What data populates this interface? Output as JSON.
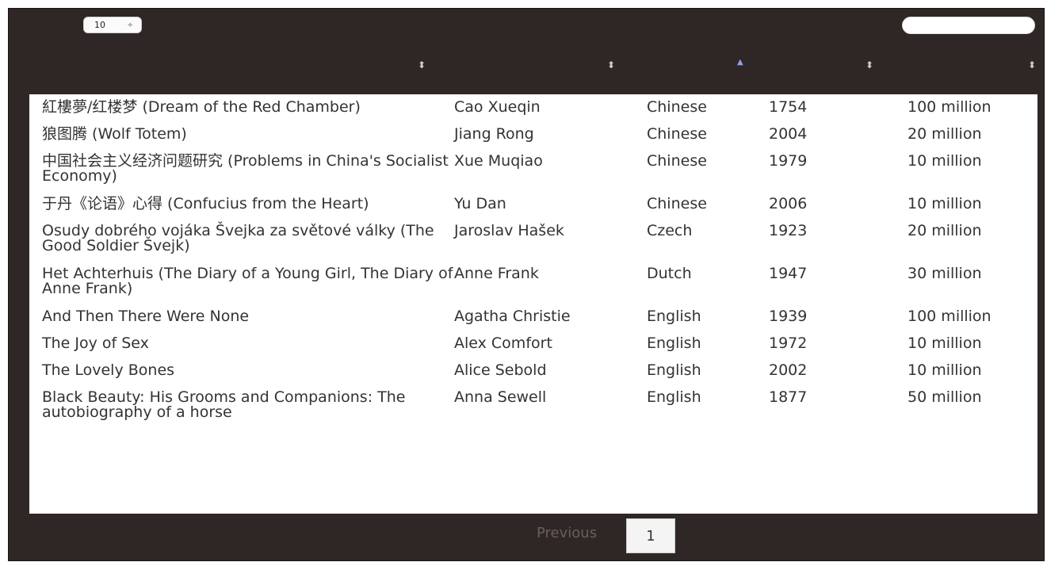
{
  "controls": {
    "page_length": "10",
    "page_length_arrows": "÷",
    "search_value": ""
  },
  "sort_icons": {
    "unsorted": "⬍",
    "ascending": "▲"
  },
  "rows": [
    {
      "title": "紅樓夢/红楼梦 (Dream of the Red Chamber)",
      "author": "Cao Xueqin",
      "language": "Chinese",
      "year": "1754",
      "sales": "100 million"
    },
    {
      "title": "狼图腾 (Wolf Totem)",
      "author": "Jiang Rong",
      "language": "Chinese",
      "year": "2004",
      "sales": "20 million"
    },
    {
      "title": "中国社会主义经济问题研究 (Problems in China's Socialist Economy)",
      "author": "Xue Muqiao",
      "language": "Chinese",
      "year": "1979",
      "sales": "10 million"
    },
    {
      "title": "于丹《论语》心得 (Confucius from the Heart)",
      "author": "Yu Dan",
      "language": "Chinese",
      "year": "2006",
      "sales": "10 million"
    },
    {
      "title": "Osudy dobrého vojáka Švejka za světové války (The Good Soldier Švejk)",
      "author": "Jaroslav Hašek",
      "language": "Czech",
      "year": "1923",
      "sales": "20 million"
    },
    {
      "title": "Het Achterhuis (The Diary of a Young Girl, The Diary of Anne Frank)",
      "author": "Anne Frank",
      "language": "Dutch",
      "year": "1947",
      "sales": "30 million"
    },
    {
      "title": "And Then There Were None",
      "author": "Agatha Christie",
      "language": "English",
      "year": "1939",
      "sales": "100 million"
    },
    {
      "title": "The Joy of Sex",
      "author": "Alex Comfort",
      "language": "English",
      "year": "1972",
      "sales": "10 million"
    },
    {
      "title": "The Lovely Bones",
      "author": "Alice Sebold",
      "language": "English",
      "year": "2002",
      "sales": "10 million"
    },
    {
      "title": "Black Beauty: His Grooms and Companions: The autobiography of a horse",
      "author": "Anna Sewell",
      "language": "English",
      "year": "1877",
      "sales": "50 million"
    }
  ],
  "pagination": {
    "previous_label": "Previous",
    "current_page": "1"
  },
  "colors": {
    "background": "#2f2626",
    "table": "#ffffff",
    "sort_active": "#8fa0e8"
  }
}
